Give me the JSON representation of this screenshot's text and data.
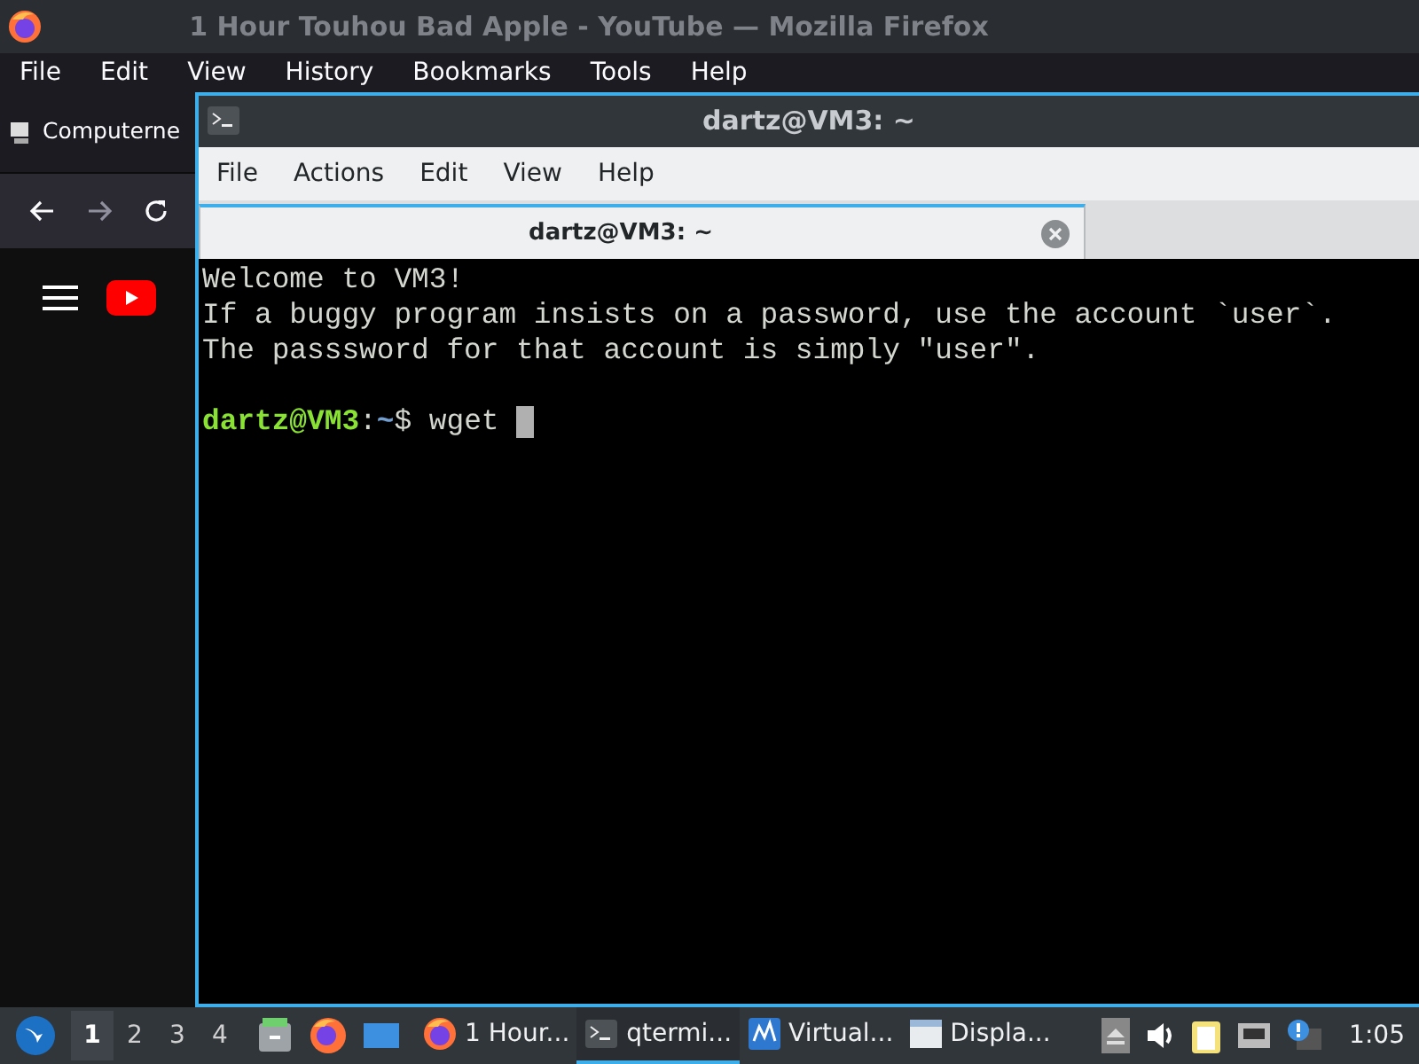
{
  "firefox": {
    "title": "1 Hour Touhou Bad Apple - YouTube — Mozilla Firefox",
    "menu": [
      "File",
      "Edit",
      "View",
      "History",
      "Bookmarks",
      "Tools",
      "Help"
    ],
    "bookmark": "Computerne"
  },
  "terminal": {
    "title": "dartz@VM3: ~",
    "menu": [
      "File",
      "Actions",
      "Edit",
      "View",
      "Help"
    ],
    "tabs": [
      {
        "label": "dartz@VM3: ~",
        "selected": true
      }
    ],
    "lines": [
      "Welcome to VM3!",
      "If a buggy program insists on a password, use the account `user`.",
      "The passsword for that account is simply \"user\"."
    ],
    "prompt": {
      "user": "dartz@VM3",
      "separator": ":",
      "path": "~",
      "symbol": "$",
      "command": "wget"
    }
  },
  "taskbar": {
    "desktops": [
      {
        "label": "1",
        "selected": true
      },
      {
        "label": "2",
        "selected": false
      },
      {
        "label": "3",
        "selected": false
      },
      {
        "label": "4",
        "selected": false
      }
    ],
    "tasks": [
      {
        "kind": "firefox",
        "label": "1 Hour...",
        "selected": false
      },
      {
        "kind": "terminal",
        "label": "qtermi...",
        "selected": true
      },
      {
        "kind": "vbox",
        "label": "Virtual...",
        "selected": false
      },
      {
        "kind": "window",
        "label": "Displa...",
        "selected": false
      }
    ],
    "clock": "1:05"
  }
}
